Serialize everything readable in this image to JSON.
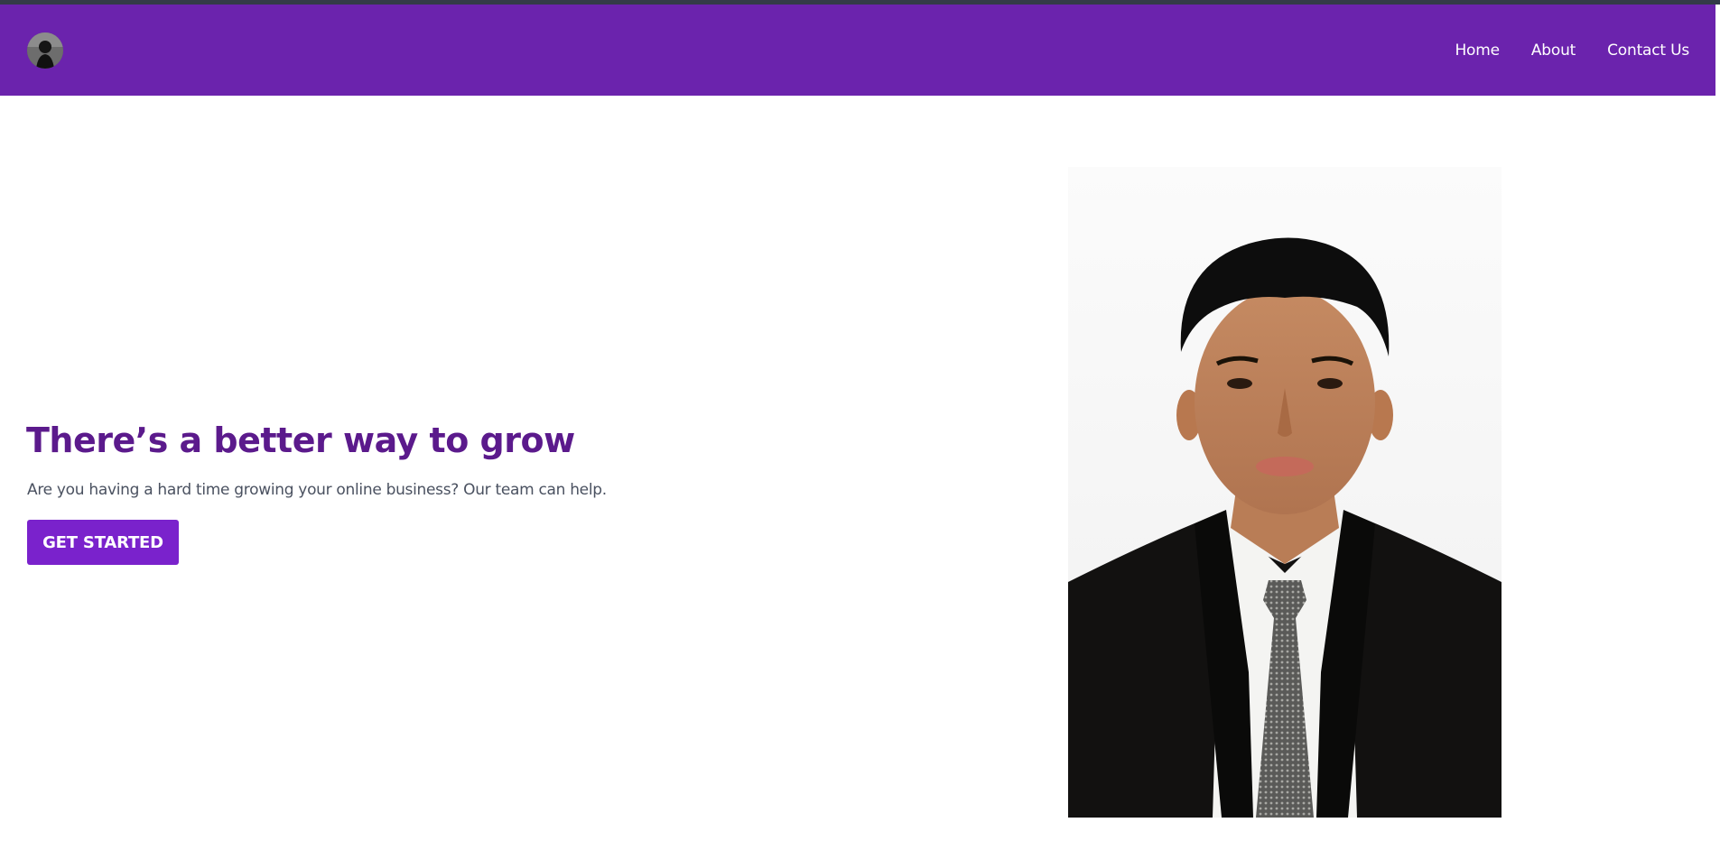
{
  "window": {
    "accent_color": "#6b23ad",
    "title_color": "#5b1a8c",
    "button_color": "#7a22cc"
  },
  "header": {
    "logo_icon": "avatar-logo-icon",
    "nav": [
      {
        "label": "Home"
      },
      {
        "label": "About"
      },
      {
        "label": "Contact Us"
      }
    ]
  },
  "hero": {
    "title": "There’s a better way to grow",
    "subtitle": "Are you having a hard time growing your online business? Our team can help.",
    "cta_label": "GET STARTED"
  },
  "portrait": {
    "icon": "portrait-photo"
  }
}
